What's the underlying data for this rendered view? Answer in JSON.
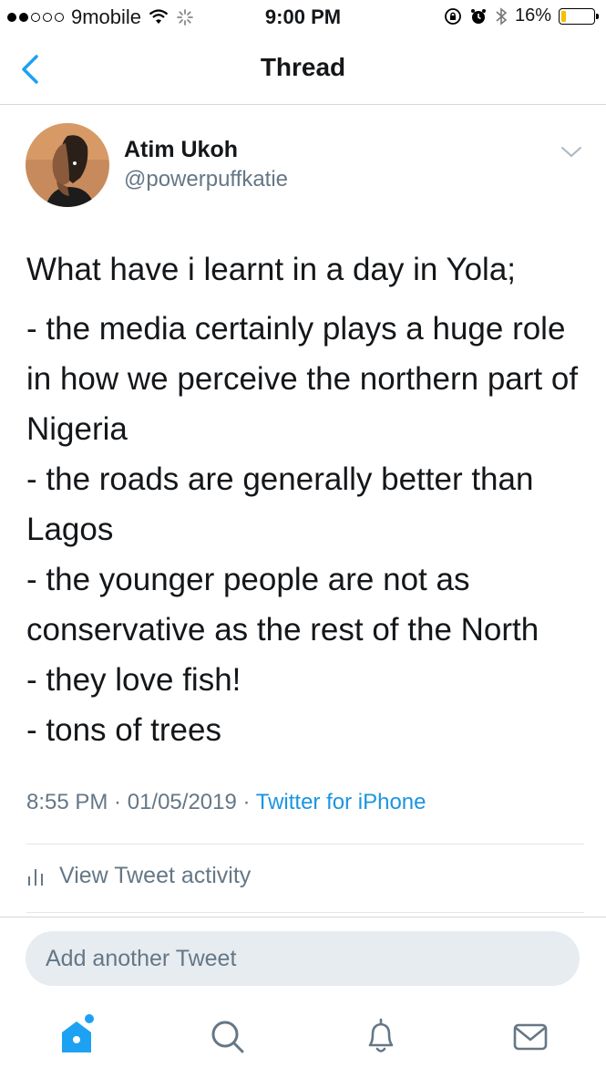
{
  "status_bar": {
    "carrier": "9mobile",
    "time": "9:00 PM",
    "battery": "16%",
    "battery_level": 0.16
  },
  "nav": {
    "title": "Thread"
  },
  "tweet": {
    "author_name": "Atim Ukoh",
    "author_handle": "@powerpuffkatie",
    "text_intro": "What have i learnt in a day in Yola;",
    "text_lines": [
      "- the media certainly plays a huge role in how we perceive the northern part of Nigeria",
      "- the roads are generally better than Lagos",
      "- the younger people are not as conservative as the rest of the North",
      "- they love fish!",
      "- tons of trees"
    ],
    "time": "8:55 PM",
    "date": "01/05/2019",
    "source": "Twitter for iPhone",
    "dot_separator": " · "
  },
  "activity": {
    "label": "View Tweet activity"
  },
  "reply": {
    "placeholder": "Add another Tweet"
  },
  "tab_bar": {
    "items": [
      "home-icon",
      "search-icon",
      "notifications-icon",
      "messages-icon"
    ],
    "active_color": "#1da1f2",
    "inactive_color": "#657786"
  }
}
